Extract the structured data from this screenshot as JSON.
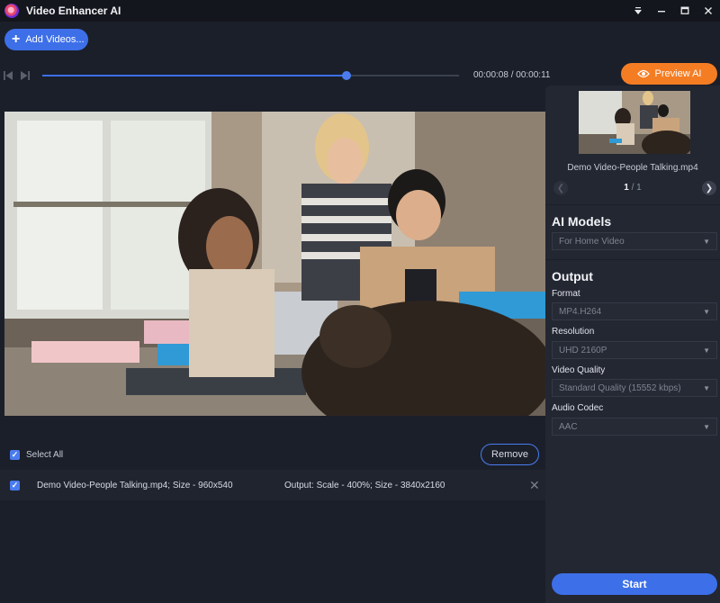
{
  "window": {
    "title": "Video Enhancer AI",
    "controls": [
      "menu-icon",
      "minimize-icon",
      "maximize-icon",
      "close-icon"
    ]
  },
  "toolbar": {
    "add_videos_label": "Add Videos...",
    "preview_label": "Preview AI"
  },
  "player": {
    "time": "00:00:08 / 00:00:11",
    "progress": 0.73
  },
  "list": {
    "select_all_label": "Select All",
    "remove_label": "Remove",
    "files": [
      {
        "name": "Demo Video-People Talking.mp4; Size - 960x540",
        "output": "Output: Scale - 400%; Size - 3840x2160",
        "checked": true
      }
    ]
  },
  "sidebar": {
    "thumb_name": "Demo Video-People Talking.mp4",
    "page_current": "1",
    "page_total": "/ 1",
    "ai_models": {
      "title": "AI Models",
      "selected": "For Home Video"
    },
    "output": {
      "title": "Output",
      "format_label": "Format",
      "format_value": "MP4.H264",
      "resolution_label": "Resolution",
      "resolution_value": "UHD 2160P",
      "quality_label": "Video Quality",
      "quality_value": "Standard Quality (15552 kbps)",
      "audio_label": "Audio Codec",
      "audio_value": "AAC"
    },
    "start_label": "Start"
  },
  "colors": {
    "accent": "#3d6fe8",
    "preview": "#f47d24",
    "background": "#1b1f2a",
    "panel": "#232732"
  }
}
